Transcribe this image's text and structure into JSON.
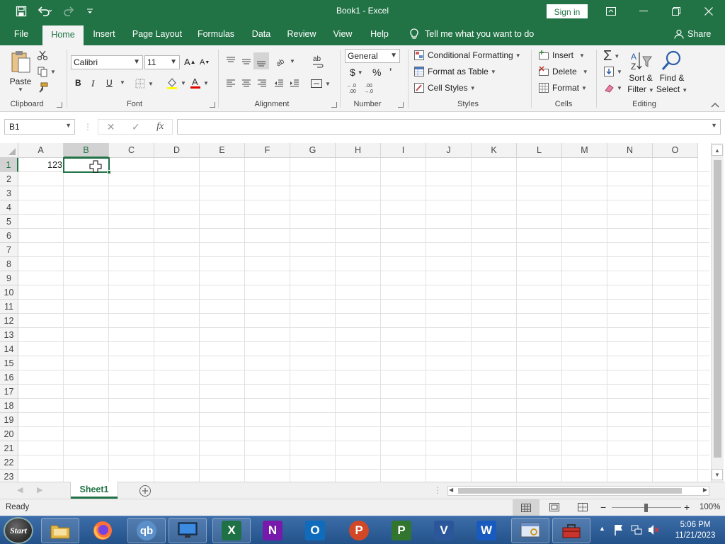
{
  "colors": {
    "excel_green": "#217346",
    "ribbon_bg": "#f3f3f3",
    "grid_line": "#e1e1e1"
  },
  "titlebar": {
    "title": "Book1  -  Excel",
    "sign_in": "Sign in",
    "quick_access_icons": [
      "save-icon",
      "undo-icon",
      "redo-icon",
      "customize-icon"
    ]
  },
  "tabs": [
    {
      "label": "File"
    },
    {
      "label": "Home"
    },
    {
      "label": "Insert"
    },
    {
      "label": "Page Layout"
    },
    {
      "label": "Formulas"
    },
    {
      "label": "Data"
    },
    {
      "label": "Review"
    },
    {
      "label": "View"
    },
    {
      "label": "Help"
    }
  ],
  "active_tab": "Home",
  "tell_me": "Tell me what you want to do",
  "share": "Share",
  "ribbon": {
    "clipboard": {
      "label": "Clipboard",
      "paste": "Paste"
    },
    "font": {
      "label": "Font",
      "font_name": "Calibri",
      "font_size": "11",
      "bold": "B",
      "italic": "I",
      "underline": "U"
    },
    "alignment": {
      "label": "Alignment"
    },
    "number": {
      "label": "Number",
      "format": "General",
      "currency": "$",
      "percent": "%",
      "comma": "’",
      "inc_decimal": ".00 →.0",
      "dec_decimal": ".00"
    },
    "styles": {
      "label": "Styles",
      "conditional": "Conditional Formatting",
      "format_table": "Format as Table",
      "cell_styles": "Cell Styles"
    },
    "cells": {
      "label": "Cells",
      "insert": "Insert",
      "delete": "Delete",
      "format": "Format"
    },
    "editing": {
      "label": "Editing",
      "sort_filter_1": "Sort &",
      "sort_filter_2": "Filter",
      "find_select_1": "Find &",
      "find_select_2": "Select"
    }
  },
  "formula_bar": {
    "name_box": "B1",
    "cancel": "✕",
    "enter": "✓",
    "fx": "fx",
    "content": ""
  },
  "columns": [
    "A",
    "B",
    "C",
    "D",
    "E",
    "F",
    "G",
    "H",
    "I",
    "J",
    "K",
    "L",
    "M",
    "N",
    "O"
  ],
  "rows": [
    "1",
    "2",
    "3",
    "4",
    "5",
    "6",
    "7",
    "8",
    "9",
    "10",
    "11",
    "12",
    "13",
    "14",
    "15",
    "16",
    "17",
    "18",
    "19",
    "20",
    "21",
    "22",
    "23"
  ],
  "selected_cell": "B1",
  "cell_values": {
    "A1": "123"
  },
  "sheets": [
    {
      "name": "Sheet1"
    }
  ],
  "status": {
    "text": "Ready",
    "zoom": "100%",
    "zoom_minus": "−",
    "zoom_plus": "+"
  },
  "taskbar": {
    "start_label": "Start",
    "qb_label": "qb",
    "apps": [
      "X",
      "N",
      "O",
      "P",
      "P",
      "V",
      "W"
    ],
    "time": "5:06 PM",
    "date": "11/21/2023"
  }
}
